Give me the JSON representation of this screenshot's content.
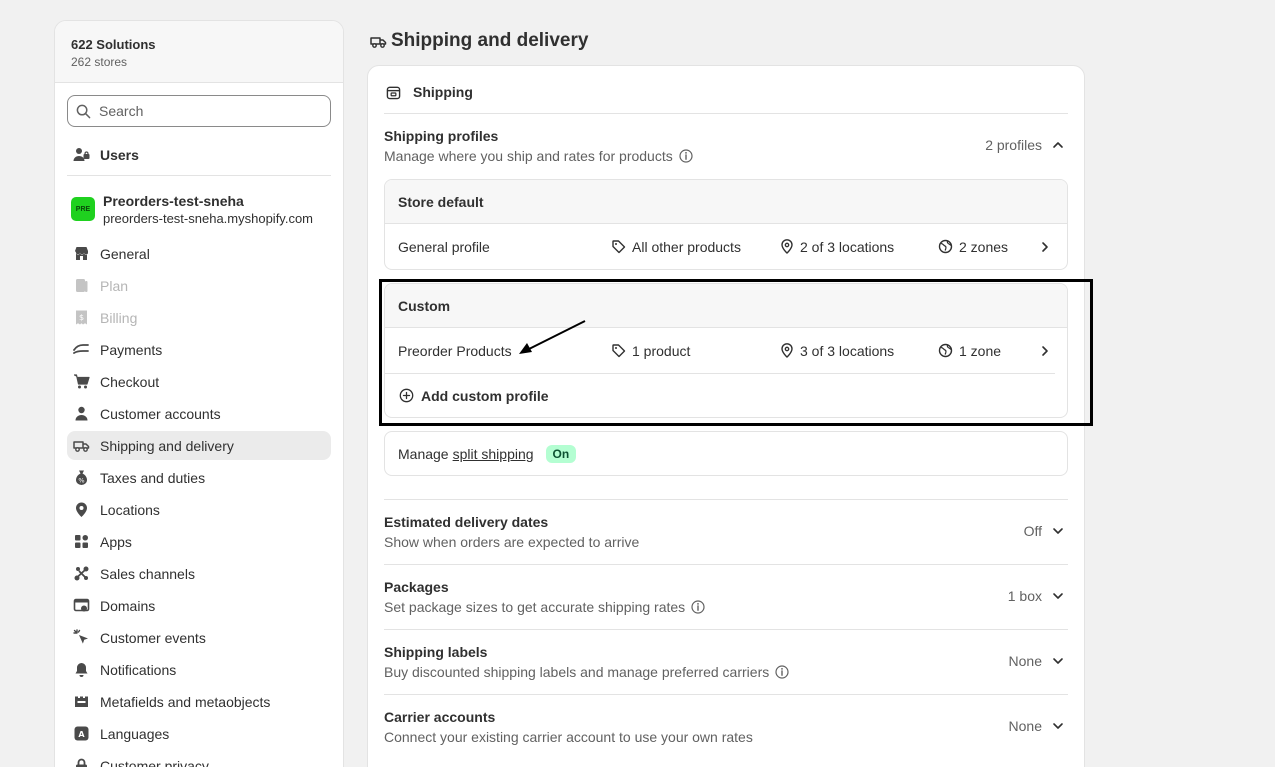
{
  "org": {
    "name": "622 Solutions",
    "subtitle": "262 stores"
  },
  "search": {
    "placeholder": "Search"
  },
  "users_label": "Users",
  "store": {
    "logo_text": "PRE",
    "name": "Preorders-test-sneha",
    "url": "preorders-test-sneha.myshopify.com"
  },
  "nav": [
    {
      "label": "General",
      "icon": "store-icon"
    },
    {
      "label": "Plan",
      "icon": "plan-icon",
      "disabled": true
    },
    {
      "label": "Billing",
      "icon": "billing-icon",
      "disabled": true
    },
    {
      "label": "Payments",
      "icon": "payments-icon"
    },
    {
      "label": "Checkout",
      "icon": "cart-icon"
    },
    {
      "label": "Customer accounts",
      "icon": "person-icon"
    },
    {
      "label": "Shipping and delivery",
      "icon": "truck-icon",
      "active": true
    },
    {
      "label": "Taxes and duties",
      "icon": "tax-icon"
    },
    {
      "label": "Locations",
      "icon": "location-icon"
    },
    {
      "label": "Apps",
      "icon": "apps-icon"
    },
    {
      "label": "Sales channels",
      "icon": "channels-icon"
    },
    {
      "label": "Domains",
      "icon": "domains-icon"
    },
    {
      "label": "Customer events",
      "icon": "events-icon"
    },
    {
      "label": "Notifications",
      "icon": "bell-icon"
    },
    {
      "label": "Metafields and metaobjects",
      "icon": "metafields-icon"
    },
    {
      "label": "Languages",
      "icon": "languages-icon"
    },
    {
      "label": "Customer privacy",
      "icon": "lock-icon"
    }
  ],
  "page": {
    "title": "Shipping and delivery"
  },
  "card": {
    "heading": "Shipping",
    "profiles": {
      "title": "Shipping profiles",
      "description": "Manage where you ship and rates for products",
      "count": "2 profiles"
    },
    "store_default": {
      "heading": "Store default",
      "row": {
        "name": "General profile",
        "products": "All other products",
        "locations": "2 of 3 locations",
        "zones": "2 zones"
      }
    },
    "custom": {
      "heading": "Custom",
      "row": {
        "name": "Preorder Products",
        "products": "1 product",
        "locations": "3 of 3 locations",
        "zones": "1 zone"
      },
      "add_label": "Add custom profile"
    },
    "split": {
      "prefix": "Manage",
      "link": "split shipping",
      "badge": "On"
    },
    "sections": [
      {
        "title": "Estimated delivery dates",
        "description": "Show when orders are expected to arrive",
        "value": "Off",
        "info": false
      },
      {
        "title": "Packages",
        "description": "Set package sizes to get accurate shipping rates",
        "value": "1 box",
        "info": true
      },
      {
        "title": "Shipping labels",
        "description": "Buy discounted shipping labels and manage preferred carriers",
        "value": "None",
        "info": true
      },
      {
        "title": "Carrier accounts",
        "description": "Connect your existing carrier account to use your own rates",
        "value": "None",
        "info": false
      }
    ]
  }
}
